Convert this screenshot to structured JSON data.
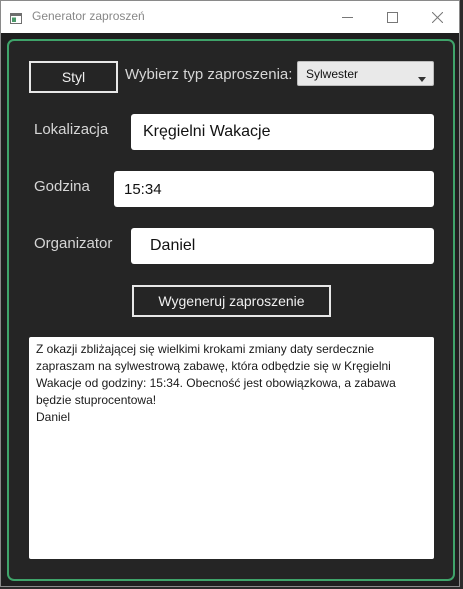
{
  "window": {
    "title": "Generator zaproszeń"
  },
  "colors": {
    "accent_border": "#3fa46a",
    "background": "#1f1f1f"
  },
  "toolbar": {
    "style_button": "Styl",
    "type_label": "Wybierz typ zaproszenia:",
    "type_select_value": "Sylwester"
  },
  "form": {
    "location_label": "Lokalizacja",
    "location_value": "Kręgielni Wakacje",
    "time_label": "Godzina",
    "time_value": "15:34",
    "organizer_label": "Organizator",
    "organizer_value": "Daniel"
  },
  "actions": {
    "generate_button": "Wygeneruj zaproszenie"
  },
  "output": {
    "text": "Z okazji zbliżającej się wielkimi krokami zmiany daty serdecznie zapraszam na sylwestrową zabawę, która odbędzie się w Kręgielni Wakacje od godziny: 15:34. Obecność jest obowiązkowa, a zabawa będzie stuprocentowa!\nDaniel"
  },
  "icons": {
    "app": "app-window-icon",
    "minimize": "minimize-icon",
    "maximize": "maximize-icon",
    "close": "close-icon",
    "dropdown": "dropdown-arrow-icon"
  }
}
